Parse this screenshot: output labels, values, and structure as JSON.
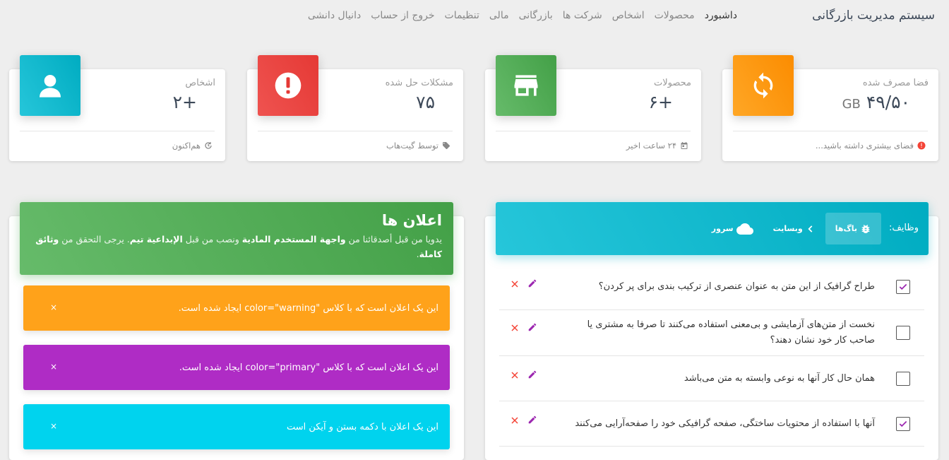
{
  "brand": "سیستم مدیریت بازرگانی",
  "nav": [
    {
      "label": "داشبورد",
      "active": true
    },
    {
      "label": "محصولات"
    },
    {
      "label": "اشخاص"
    },
    {
      "label": "شرکت ها"
    },
    {
      "label": "بازرگانی"
    },
    {
      "label": "مالی"
    },
    {
      "label": "تنظیمات"
    },
    {
      "label": "خروج از حساب"
    },
    {
      "label": "دانیال دانشی"
    }
  ],
  "stats": [
    {
      "category": "فضا مصرف شده",
      "value": "۴۹/۵۰",
      "unit": "GB",
      "footer": "فضای بیشتری داشته باشید...",
      "color": "#ff9800",
      "icon": "refresh-icon",
      "footer_icon": "error-icon"
    },
    {
      "category": "محصولات",
      "value": "+۶",
      "unit": "",
      "footer": "۲۴ ساعت اخیر",
      "color": "#4caf50",
      "icon": "store-icon",
      "footer_icon": "calendar-icon"
    },
    {
      "category": "مشکلات حل شده",
      "value": "۷۵",
      "unit": "",
      "footer": "توسط گیت‌هاب",
      "color": "#e53935",
      "icon": "alert-icon",
      "footer_icon": "tag-icon"
    },
    {
      "category": "اشخاص",
      "value": "+۲",
      "unit": "",
      "footer": "هم‌اکنون",
      "color": "#00acc1",
      "icon": "person-icon",
      "footer_icon": "update-icon"
    }
  ],
  "tasks": {
    "title": "وظایف:",
    "tabs": [
      {
        "label": "باگ‌ها",
        "active": true,
        "icon": "bug-icon"
      },
      {
        "label": "وبسایت",
        "icon": "code-icon"
      },
      {
        "label": "سرور",
        "icon": "cloud-icon"
      }
    ],
    "items": [
      {
        "text": "طراح گرافیک از این متن به عنوان عنصری از ترکیب بندی برای پر کردن؟",
        "checked": true
      },
      {
        "text": "نخست از متن‌های آزمایشی و بی‌معنی استفاده می‌کنند تا صرفا به مشتری یا صاحب کار خود نشان دهند؟",
        "checked": false
      },
      {
        "text": "همان حال کار آنها به نوعی وابسته به متن می‌باشد",
        "checked": false
      },
      {
        "text": "آنها با استفاده از محتویات ساختگی، صفحه گرافیکی خود را صفحه‌آرایی می‌کنند",
        "checked": true
      }
    ],
    "colors": {
      "edit": "#9c27b0",
      "delete": "#f44336"
    }
  },
  "notifications": {
    "title": "اعلان ها",
    "sub_1": "يدويا من قبل أصدقائنا من ",
    "sub_2": "واجهة المستخدم المادية",
    "sub_3": " ونصب من قبل ",
    "sub_4": "الإبداعية تيم",
    "sub_5": ". يرجى التحقق من ",
    "sub_6": "وثائق كاملة",
    "sub_7": ".",
    "alerts": [
      {
        "text": "این یک اعلان است که با کلاس \"color=\"warning ایجاد شده است.",
        "color": "#ffa21a"
      },
      {
        "text": "این یک اعلان است که با کلاس \"color=\"primary ایجاد شده است.",
        "color": "#af2cc5"
      },
      {
        "text": "این یک اعلان با دکمه بستن و آیکن است",
        "color": "#00d3ee"
      }
    ],
    "close_glyph": "×"
  }
}
